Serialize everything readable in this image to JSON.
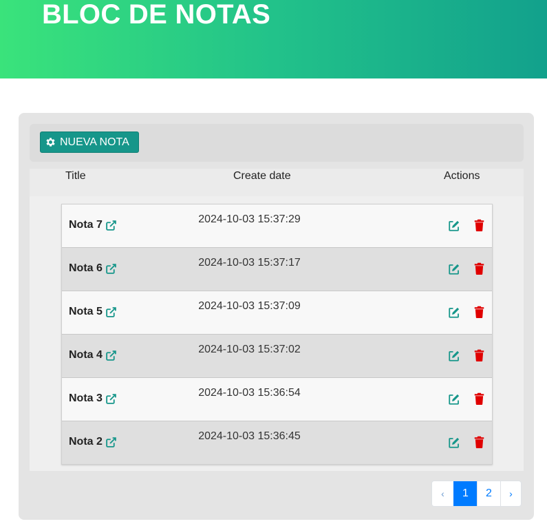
{
  "header": {
    "title": "BLOC DE NOTAS"
  },
  "toolbar": {
    "new_button_label": "NUEVA NOTA",
    "new_button_icon": "gear-icon"
  },
  "table": {
    "columns": {
      "title": "Title",
      "date": "Create date",
      "actions": "Actions"
    },
    "rows": [
      {
        "title": "Nota 7",
        "date": "2024-10-03 15:37:29"
      },
      {
        "title": "Nota 6",
        "date": "2024-10-03 15:37:17"
      },
      {
        "title": "Nota 5",
        "date": "2024-10-03 15:37:09"
      },
      {
        "title": "Nota 4",
        "date": "2024-10-03 15:37:02"
      },
      {
        "title": "Nota 3",
        "date": "2024-10-03 15:36:54"
      },
      {
        "title": "Nota 2",
        "date": "2024-10-03 15:36:45"
      }
    ]
  },
  "pagination": {
    "prev": "‹",
    "pages": [
      "1",
      "2"
    ],
    "current": "1",
    "next": "›"
  },
  "colors": {
    "accent": "#16968a",
    "delete": "#e00000",
    "page_active": "#007bff"
  }
}
